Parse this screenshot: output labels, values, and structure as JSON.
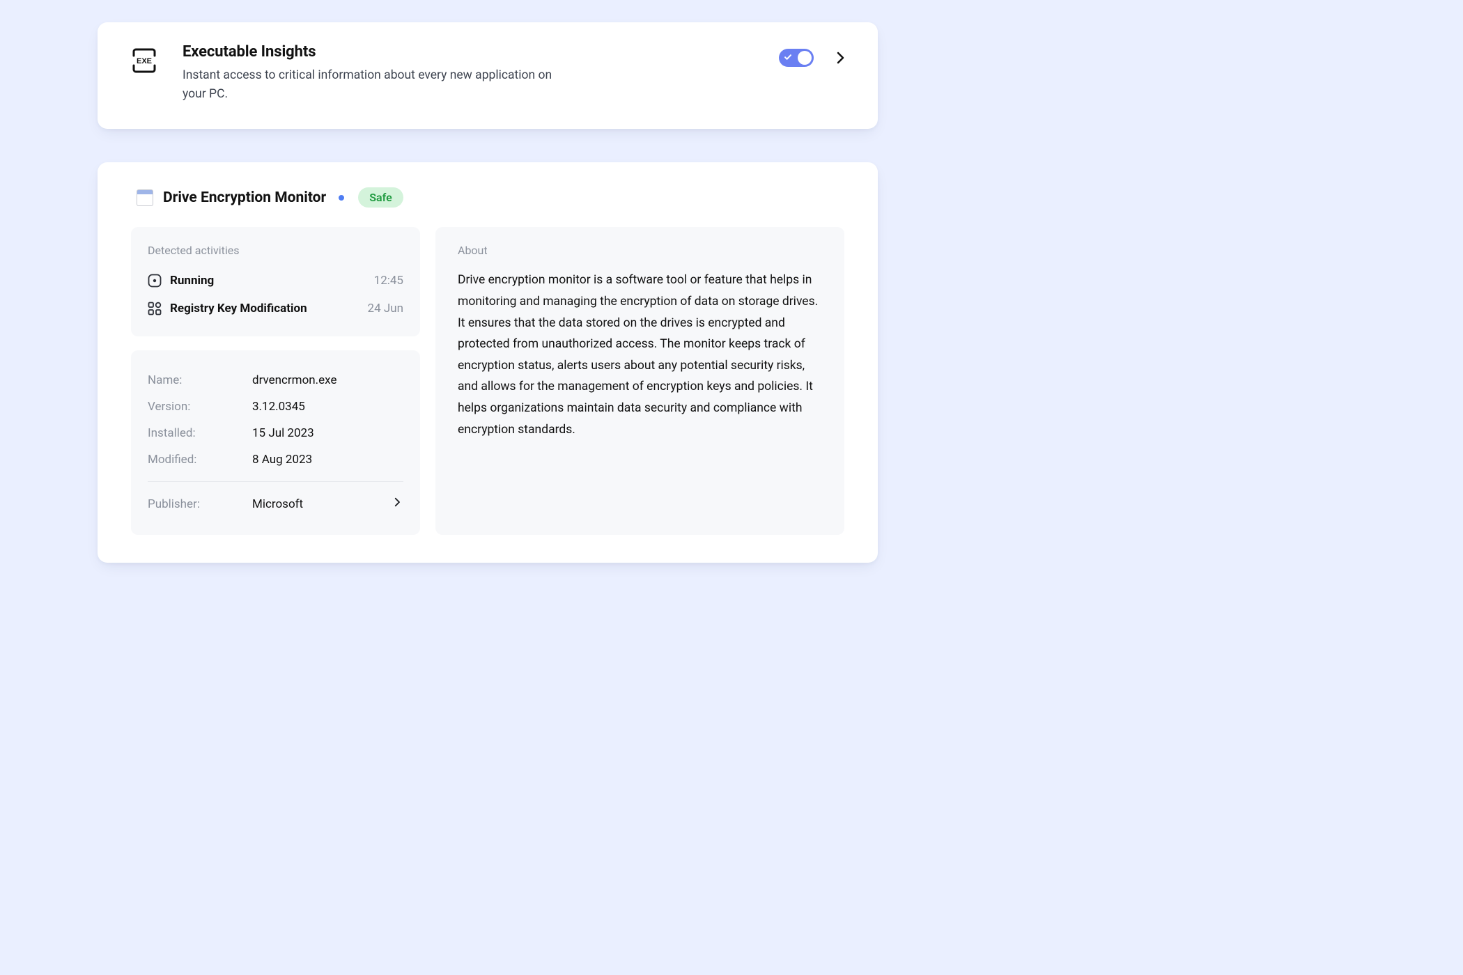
{
  "feature": {
    "title": "Executable Insights",
    "description": "Instant access to critical information about every new application on your PC."
  },
  "program": {
    "title": "Drive Encryption Monitor",
    "safety_badge": "Safe"
  },
  "activities": {
    "heading": "Detected activities",
    "items": [
      {
        "label": "Running",
        "time": "12:45"
      },
      {
        "label": "Registry Key Modification",
        "time": "24 Jun"
      }
    ]
  },
  "facts": {
    "name_label": "Name:",
    "name_value": "drvencrmon.exe",
    "version_label": "Version:",
    "version_value": "3.12.0345",
    "installed_label": "Installed:",
    "installed_value": "15 Jul 2023",
    "modified_label": "Modified:",
    "modified_value": "8 Aug 2023",
    "publisher_label": "Publisher:",
    "publisher_value": "Microsoft"
  },
  "about": {
    "heading": "About",
    "body": "Drive encryption monitor is a software tool or feature that helps in monitoring and managing the encryption of data on storage drives. It ensures that the data stored on the drives is encrypted and protected from unauthorized access. The monitor keeps track of encryption status, alerts users about any potential security risks, and allows for the management of encryption keys and policies. It helps organizations maintain data security and compliance with encryption standards."
  }
}
